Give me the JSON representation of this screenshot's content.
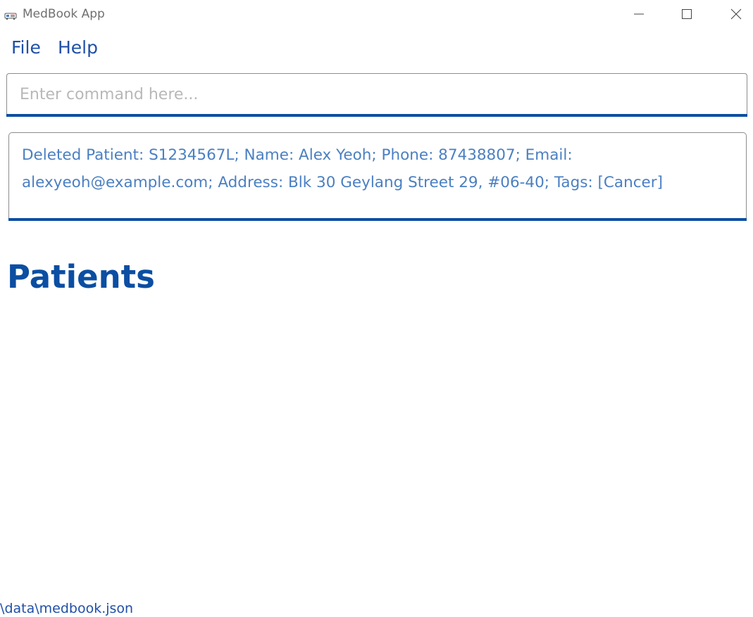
{
  "window": {
    "title": "MedBook App",
    "controls": {
      "minimize": "minimize-icon",
      "maximize": "maximize-icon",
      "close": "close-icon"
    }
  },
  "menu": {
    "items": [
      {
        "label": "File"
      },
      {
        "label": "Help"
      }
    ]
  },
  "command": {
    "value": "",
    "placeholder": "Enter command here..."
  },
  "result": {
    "text": "Deleted Patient: S1234567L; Name: Alex Yeoh; Phone: 87438807; Email: alexyeoh@example.com; Address: Blk 30 Geylang Street 29, #06-40; Tags: [Cancer]"
  },
  "patients": {
    "heading": "Patients",
    "items": []
  },
  "status_bar": {
    "file_path": ".\\data\\medbook.json"
  },
  "colors": {
    "accent": "#0b4ea2",
    "menu_text": "#1f4fa8",
    "result_text": "#4a7fc2",
    "border": "#8c8c8c"
  }
}
